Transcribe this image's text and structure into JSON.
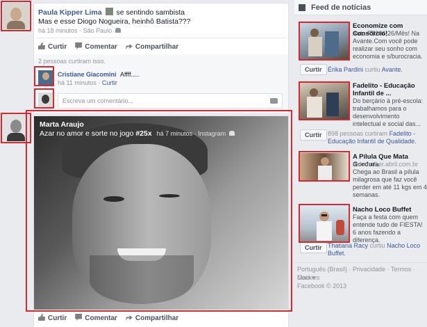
{
  "post1": {
    "author": "Paula Kipper Lima",
    "feeling": "se sentindo sambista",
    "text": "Mas e esse Diogo Nogueira, heinhô Batista???",
    "time": "há 18 minutos",
    "location": "São Paulo",
    "actions": {
      "like": "Curtir",
      "comment": "Comentar",
      "share": "Compartilhar"
    },
    "likes_summary": "2 pessoas curtiram isso.",
    "comment": {
      "author": "Cristiane Giacomini",
      "text": "Affff.....",
      "time": "há 11 minutos",
      "like": "Curtir"
    },
    "comment_placeholder": "Escreva um comentário..."
  },
  "post2": {
    "author": "Marta Araujo",
    "text": "Azar no amor e sorte no jogo",
    "hashtag": "#25x",
    "time": "há 7 minutos",
    "via": "Instagram",
    "actions": {
      "like": "Curtir",
      "comment": "Comentar",
      "share": "Compartilhar"
    }
  },
  "sidebar": {
    "title": "Feed de notícias",
    "ads": [
      {
        "title": "Economize com Consórcio!",
        "desc": "Auto R$206,26/Mês! Na Avante.Com você pode realizar seu sonho com economia e s/burocracia.",
        "button": "Curtir",
        "social_name": "Érika Pardini",
        "social_text": "curtiu",
        "social_page": "Avante."
      },
      {
        "title": "Fadelito - Educação Infantil de ...",
        "desc": "Do berçário à pré-escola: trabalhamos para o desenvolvimento intelectual e social das...",
        "button": "Curtir",
        "social_text": "898 pessoas curtiram",
        "social_page": "Fadelito - Educação Infantil de Qualidade."
      },
      {
        "title": "A Pílula Que Mata Gordura",
        "source": "mdemulher.abril.com.br",
        "desc": "Chega ao Brasil a pílula milagrosa que faz você perder em até 11 kgs em 4 semanas."
      },
      {
        "title": "Nacho Loco Buffet",
        "desc": "Faça a festa com quem entende tudo de FIESTA! 6 anos fazendo a diferença.",
        "button": "Curtir",
        "social_name": "Thatiana Racy",
        "social_text": "curtiu",
        "social_page": "Nacho Loco Buffet."
      }
    ],
    "footer": {
      "lang": "Português (Brasil)",
      "privacy": "Privacidade",
      "terms": "Termos",
      "cookies": "Cookies",
      "more": "Mais",
      "copyright": "Facebook © 2013"
    }
  },
  "colors": {
    "brand": "#3b5998",
    "highlight": "#d9262f"
  }
}
